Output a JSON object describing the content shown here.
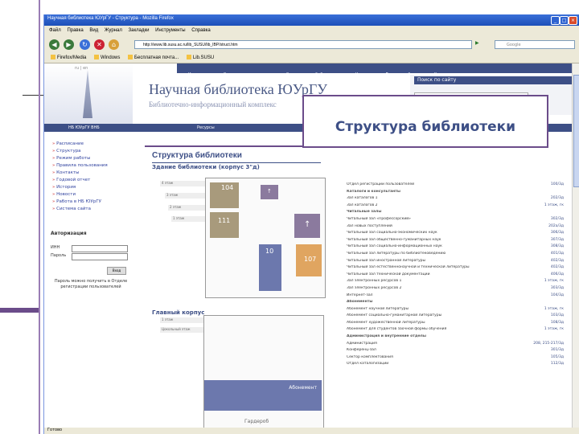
{
  "browser": {
    "title": "Научная библиотека ЮУрГУ - Структура - Mozilla Firefox",
    "menu": [
      "Файл",
      "Правка",
      "Вид",
      "Журнал",
      "Закладки",
      "Инструменты",
      "Справка"
    ],
    "address": "http://www.lib.susu.ac.ru/lib_SUSU/lib_IBP/struct.htm",
    "search_engine": "Google",
    "bookmarks": [
      "Firefox/Media",
      "Windows",
      "Бесплатная почта...",
      "Lib.SUSU"
    ],
    "status": "Готово"
  },
  "site": {
    "nav": [
      "Каталоги",
      "Электронные ресурсы",
      "Электронная библиотека",
      "Услуги",
      "Лучшие работы",
      "Контакты"
    ],
    "langs": "ru | en",
    "title": "Научная библиотека ЮУрГУ",
    "subtitle": "Библиотечно-информационный комплекс",
    "search_panel_title": "Поиск по сайту",
    "bar_left": "НБ ЮУрГУ ВНБ",
    "bar_right": "Ресурсы",
    "left_nav": [
      "Расписание",
      "Структура",
      "Режим работы",
      "Правила пользования",
      "Контакты",
      "Годовой отчет",
      "История",
      "Новости",
      "Работа в НБ ЮУрГУ",
      "Система сайта"
    ],
    "auth": {
      "title": "Авторизация",
      "login_label": "ИНН",
      "password_label": "Пароль",
      "button": "Вход",
      "forgot": "Пароль можно получить в Отделе регистрации пользователей"
    },
    "page_title": "Структура библиотеки",
    "building_title": "Здание библиотеки (корпус 3\"д)",
    "floors": [
      "4 этаж",
      "3 этаж",
      "2 этаж",
      "1 этаж"
    ],
    "rooms": [
      "104",
      "111",
      "107"
    ],
    "chief_title": "Главный корпус",
    "chief_floors": [
      "1 этаж",
      "Цокольный этаж"
    ],
    "chief_block": "Абонемент",
    "wardrobe": "Гардероб"
  },
  "library_list": [
    {
      "label": "Отдел регистрации пользователей",
      "room": "100/3д"
    },
    {
      "label": "Каталоги и консультанты",
      "room": "",
      "section": true
    },
    {
      "label": "Зал каталогов 1",
      "room": "202/3д"
    },
    {
      "label": "Зал каталогов 2",
      "room": "1 этаж, гк"
    },
    {
      "label": "Читальные залы",
      "room": "",
      "section": true
    },
    {
      "label": "Читальный зал «Профессорский»",
      "room": "302/3д"
    },
    {
      "label": "Зал новых поступлений",
      "room": "202а/3д"
    },
    {
      "label": "Читальный зал социально-экономических наук",
      "room": "306/3д"
    },
    {
      "label": "Читальный зал общественно-гуманитарных наук",
      "room": "307/3д"
    },
    {
      "label": "Читальный зал социально-информационных наук",
      "room": "308/3д"
    },
    {
      "label": "Читальный зал литературы по библиотековедению",
      "room": "401/3д"
    },
    {
      "label": "Читальный зал иностранной литературы",
      "room": "402/3д"
    },
    {
      "label": "Читальный зал естественнонаучной и технической литературы",
      "room": "402/3д"
    },
    {
      "label": "Читальный зал технической документации",
      "room": "406/3д"
    },
    {
      "label": "Зал электронных ресурсов 1",
      "room": "1 этаж, гк"
    },
    {
      "label": "Зал электронных ресурсов 2",
      "room": "303/3д"
    },
    {
      "label": "Интернет-зал",
      "room": "104/3д"
    },
    {
      "label": "Абонементы",
      "room": "",
      "section": true
    },
    {
      "label": "Абонемент научной литературы",
      "room": "1 этаж, гк"
    },
    {
      "label": "Абонемент социально-гуманитарной литературы",
      "room": "103/3д"
    },
    {
      "label": "Абонемент художественной литературы",
      "room": "108/3д"
    },
    {
      "label": "Абонемент для студентов заочной формы обучения",
      "room": "1 этаж, гк"
    },
    {
      "label": "Администрация и внутренние отделы",
      "room": "",
      "section": true
    },
    {
      "label": "Администрация",
      "room": "208, 215-217/3д"
    },
    {
      "label": "Конференц-зал",
      "room": "301/3д"
    },
    {
      "label": "Сектор комплектования",
      "room": "105/3д"
    },
    {
      "label": "Отдел каталогизации",
      "room": "112/3д"
    }
  ],
  "callout": {
    "text": "Структура библиотеки"
  }
}
